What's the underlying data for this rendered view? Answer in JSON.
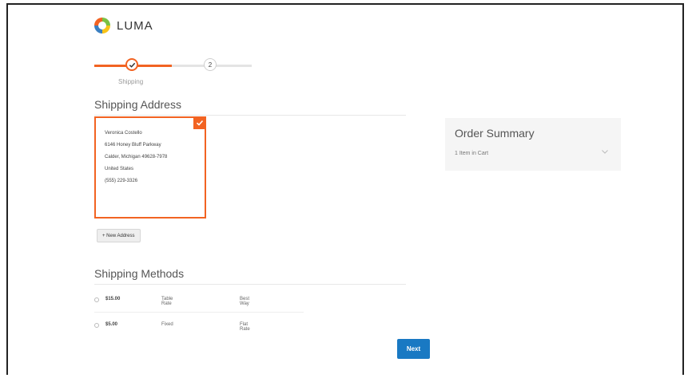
{
  "brand": {
    "name": "LUMA",
    "colors": {
      "orange": "#f26322",
      "blue": "#1979c3",
      "green": "#7bc143",
      "yellow": "#f8c319"
    }
  },
  "progress": {
    "steps": [
      {
        "label": "Shipping",
        "state": "complete",
        "icon": "check-icon"
      },
      {
        "label": "",
        "number": "2",
        "state": "pending"
      }
    ]
  },
  "shipping_address": {
    "title": "Shipping Address",
    "selected_card": {
      "lines": [
        "Veronica Costello",
        "6146 Honey Bluff Parkway",
        "Calder, Michigan 49628-7978",
        "United States",
        "(555) 229-3326"
      ],
      "selected_icon": "check-icon"
    },
    "new_address_label": "+ New Address"
  },
  "order_summary": {
    "title": "Order Summary",
    "items_in_cart": "1 Item in Cart",
    "toggle_icon": "chevron-down-icon"
  },
  "shipping_methods": {
    "title": "Shipping Methods",
    "rows": [
      {
        "price": "$15.00",
        "method_title": "Table Rate",
        "carrier": "Best Way",
        "selected": false
      },
      {
        "price": "$5.00",
        "method_title": "Fixed",
        "carrier": "Flat Rate",
        "selected": false
      }
    ]
  },
  "actions": {
    "next_label": "Next"
  }
}
